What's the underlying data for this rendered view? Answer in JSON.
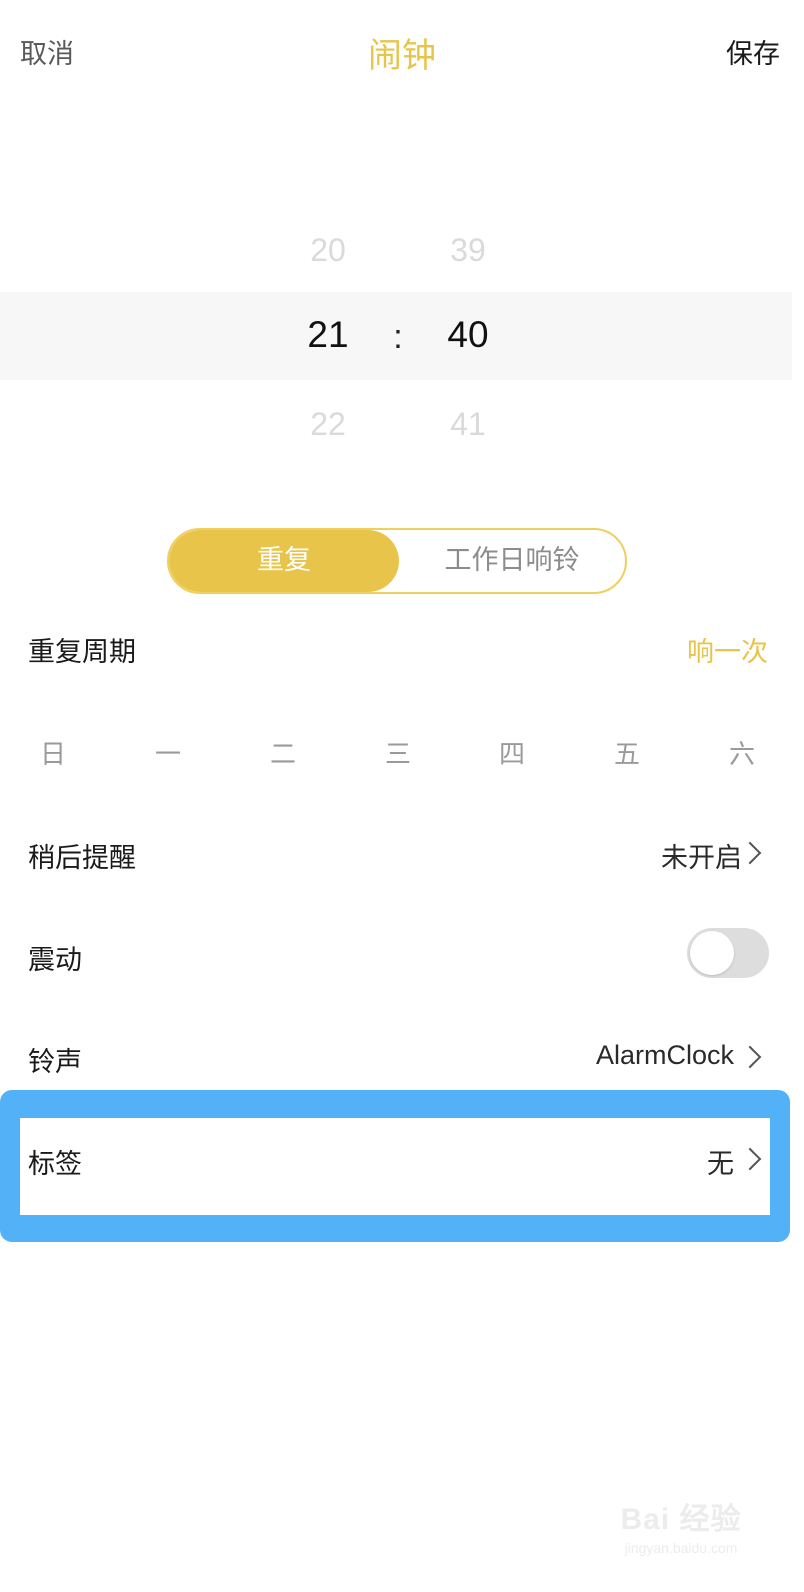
{
  "header": {
    "cancel_label": "取消",
    "title": "闹钟",
    "save_label": "保存"
  },
  "time_picker": {
    "hour_prev": "20",
    "hour_selected": "21",
    "hour_next": "22",
    "separator": ":",
    "minute_prev": "39",
    "minute_selected": "40",
    "minute_next": "41"
  },
  "mode_toggle": {
    "active_label": "重复",
    "inactive_label": "工作日响铃"
  },
  "repeat_cycle": {
    "label": "重复周期",
    "value": "响一次"
  },
  "weekdays": [
    "日",
    "一",
    "二",
    "三",
    "四",
    "五",
    "六"
  ],
  "snooze": {
    "label": "稍后提醒",
    "value": "未开启"
  },
  "vibrate": {
    "label": "震动",
    "on": false
  },
  "ringtone": {
    "label": "铃声",
    "value": "AlarmClock"
  },
  "tag": {
    "label": "标签",
    "value": "无"
  },
  "watermark": {
    "main": "Bai 经验",
    "sub": "jingyan.baidu.com"
  },
  "colors": {
    "accent": "#e8c44a",
    "highlight_frame": "#52b1f7",
    "switch_off": "#dddddd"
  }
}
